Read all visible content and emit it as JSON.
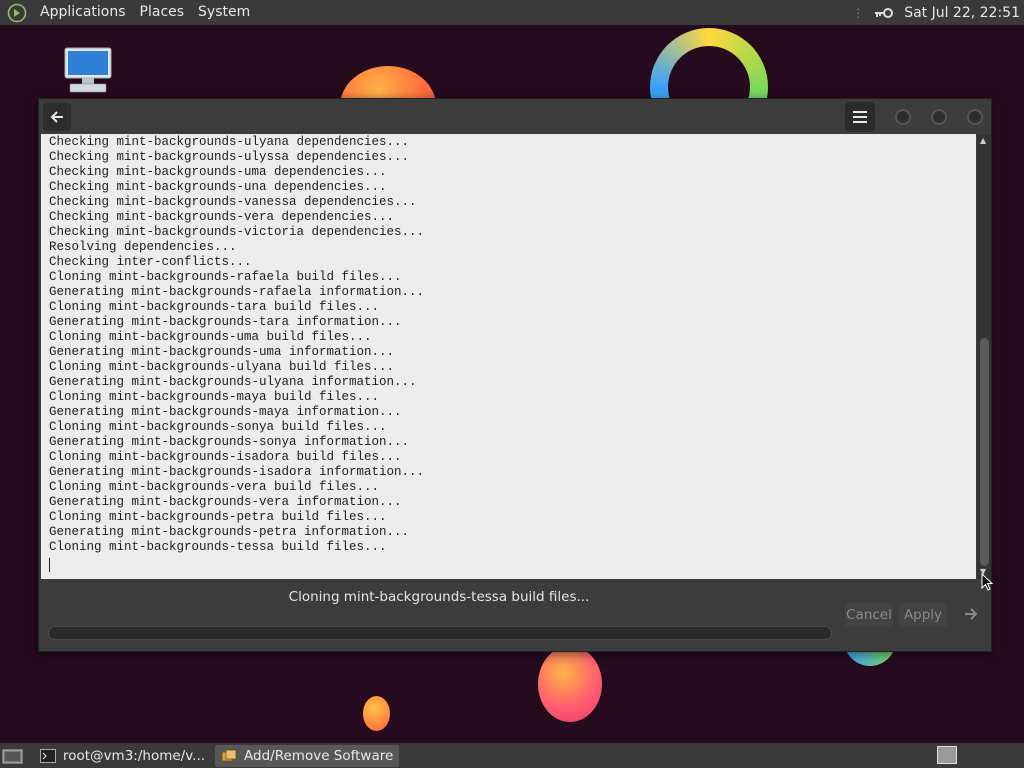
{
  "top_panel": {
    "menus": [
      "Applications",
      "Places",
      "System"
    ],
    "clock": "Sat Jul 22, 22:51",
    "icons": [
      "mint-menu-icon",
      "key-icon"
    ]
  },
  "window": {
    "title_icons": [
      "back-arrow-icon",
      "hamburger-menu-icon"
    ],
    "log_lines": [
      "Checking mint-backgrounds-ulyana dependencies...",
      "Checking mint-backgrounds-ulyssa dependencies...",
      "Checking mint-backgrounds-uma dependencies...",
      "Checking mint-backgrounds-una dependencies...",
      "Checking mint-backgrounds-vanessa dependencies...",
      "Checking mint-backgrounds-vera dependencies...",
      "Checking mint-backgrounds-victoria dependencies...",
      "Resolving dependencies...",
      "Checking inter-conflicts...",
      "Cloning mint-backgrounds-rafaela build files...",
      "Generating mint-backgrounds-rafaela information...",
      "Cloning mint-backgrounds-tara build files...",
      "Generating mint-backgrounds-tara information...",
      "Cloning mint-backgrounds-uma build files...",
      "Generating mint-backgrounds-uma information...",
      "Cloning mint-backgrounds-ulyana build files...",
      "Generating mint-backgrounds-ulyana information...",
      "Cloning mint-backgrounds-maya build files...",
      "Generating mint-backgrounds-maya information...",
      "Cloning mint-backgrounds-sonya build files...",
      "Generating mint-backgrounds-sonya information...",
      "Cloning mint-backgrounds-isadora build files...",
      "Generating mint-backgrounds-isadora information...",
      "Cloning mint-backgrounds-vera build files...",
      "Generating mint-backgrounds-vera information...",
      "Cloning mint-backgrounds-petra build files...",
      "Generating mint-backgrounds-petra information...",
      "Cloning mint-backgrounds-tessa build files..."
    ],
    "status": "Cloning mint-backgrounds-tessa build files...",
    "cancel_label": "Cancel",
    "apply_label": "Apply",
    "progress": 0
  },
  "taskbar": {
    "tasks": [
      {
        "label": "root@vm3:/home/v...",
        "icon": "terminal-icon",
        "active": false
      },
      {
        "label": "Add/Remove Software",
        "icon": "package-icon",
        "active": true
      }
    ]
  },
  "colors": {
    "wallpaper": "#260b1f",
    "panel": "#3a3a3a",
    "window": "#3c3c3c",
    "terminal_bg": "#ececec"
  }
}
